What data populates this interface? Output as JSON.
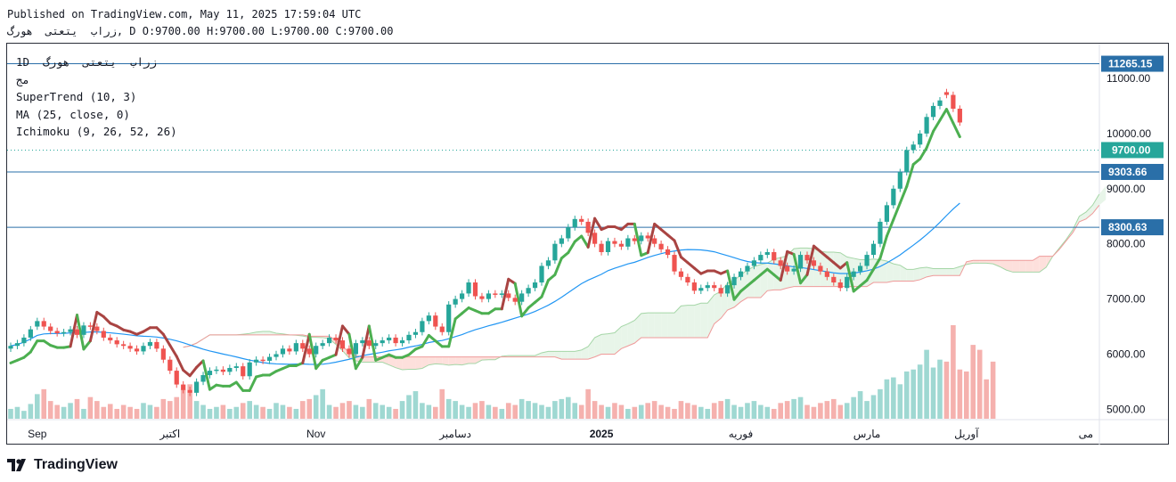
{
  "header": {
    "published": "Published on TradingView.com, May 11, 2025 17:59:04 UTC",
    "symbol_line": "زراب  يتعتى  هورگ, D O:9700.00 H:9700.00 L:9700.00 C:9700.00"
  },
  "legend": {
    "line1": "1D  زراب  يتعتى  هورگ",
    "line2": "مج",
    "supertrend": "SuperTrend (10, 3)",
    "ma": "MA (25, close, 0)",
    "ichimoku": "Ichimoku (9, 26, 52, 26)"
  },
  "brand": {
    "name": "TradingView"
  },
  "colors": {
    "up": "#26a69a",
    "down": "#ef5350",
    "supertrend_up": "#4caf50",
    "supertrend_down": "#a94442",
    "ma": "#2196f3",
    "cloud_green": "#e8f5e9",
    "cloud_red": "#fde0dc",
    "hline": "#2a6fa8",
    "price_label": "#26a69a",
    "hline_label": "#2a6fa8"
  },
  "chart_data": {
    "type": "candlestick",
    "ylim": [
      4700,
      11500
    ],
    "yticks": [
      11000,
      10000,
      9000,
      8000,
      7000,
      6000,
      5000
    ],
    "ytick_labels": [
      "11000.00",
      "10000.00",
      "9000.00",
      "8000.00",
      "7000.00",
      "6000.00",
      "5000.00"
    ],
    "xticks": [
      {
        "label": "Sep",
        "bar": 4
      },
      {
        "label": "اکتبر",
        "bar": 24
      },
      {
        "label": "Nov",
        "bar": 46
      },
      {
        "label": "دسامبر",
        "bar": 67
      },
      {
        "label": "2025",
        "bar": 89,
        "bold": true
      },
      {
        "label": "فوریه",
        "bar": 110
      },
      {
        "label": "مارس",
        "bar": 129
      },
      {
        "label": "آوریل",
        "bar": 144
      },
      {
        "label": "می",
        "bar": 162
      }
    ],
    "horizontal_lines": [
      {
        "value": 11265.15,
        "label": "11265.15"
      },
      {
        "value": 9303.66,
        "label": "9303.66"
      },
      {
        "value": 8300.63,
        "label": "8300.63"
      }
    ],
    "last_price": {
      "value": 9700.0,
      "label": "9700.00"
    },
    "close": [
      6150,
      6200,
      6300,
      6450,
      6600,
      6500,
      6420,
      6380,
      6400,
      6450,
      6350,
      6520,
      6500,
      6420,
      6300,
      6250,
      6180,
      6150,
      6100,
      6050,
      6150,
      6220,
      6100,
      5900,
      5700,
      5450,
      5350,
      5300,
      5500,
      5620,
      5700,
      5720,
      5680,
      5750,
      5780,
      5600,
      5850,
      5900,
      5880,
      5950,
      6000,
      6100,
      6050,
      6200,
      6100,
      6000,
      6150,
      6200,
      6300,
      6250,
      6100,
      6000,
      6200,
      6250,
      6150,
      6200,
      6250,
      6300,
      6200,
      6250,
      6350,
      6400,
      6600,
      6700,
      6500,
      6400,
      6900,
      7000,
      7100,
      7300,
      7050,
      7000,
      7100,
      7080,
      7100,
      7020,
      6950,
      7100,
      7200,
      7300,
      7600,
      7700,
      8000,
      8100,
      8300,
      8450,
      8400,
      8200,
      8000,
      7850,
      8050,
      8000,
      7950,
      8100,
      8050,
      8150,
      8100,
      8000,
      7900,
      7800,
      7500,
      7400,
      7300,
      7150,
      7200,
      7250,
      7200,
      7100,
      7250,
      7400,
      7500,
      7600,
      7700,
      7800,
      7850,
      7700,
      7600,
      7500,
      7550,
      7800,
      7700,
      7600,
      7500,
      7400,
      7300,
      7200,
      7400,
      7500,
      7600,
      7800,
      8000,
      8400,
      8700,
      9000,
      9300,
      9700,
      9800,
      10000,
      10300,
      10500,
      10600,
      10700,
      10450,
      10200
    ],
    "open": [
      6100,
      6150,
      6200,
      6300,
      6500,
      6600,
      6500,
      6420,
      6380,
      6400,
      6450,
      6350,
      6520,
      6500,
      6420,
      6300,
      6250,
      6180,
      6150,
      6100,
      6050,
      6150,
      6220,
      6100,
      5900,
      5700,
      5450,
      5350,
      5300,
      5500,
      5620,
      5700,
      5720,
      5680,
      5750,
      5780,
      5600,
      5850,
      5900,
      5880,
      5950,
      6000,
      6100,
      6050,
      6200,
      6100,
      6000,
      6150,
      6200,
      6300,
      6250,
      6100,
      6000,
      6200,
      6250,
      6150,
      6200,
      6250,
      6300,
      6200,
      6250,
      6350,
      6400,
      6600,
      6700,
      6500,
      6400,
      6900,
      7000,
      7100,
      7300,
      7050,
      7000,
      7100,
      7080,
      7100,
      7020,
      6950,
      7100,
      7200,
      7300,
      7600,
      7700,
      8000,
      8100,
      8300,
      8450,
      8400,
      8200,
      8000,
      7850,
      8050,
      8000,
      7950,
      8100,
      8050,
      8150,
      8100,
      8000,
      7900,
      7800,
      7500,
      7400,
      7300,
      7150,
      7200,
      7250,
      7200,
      7100,
      7250,
      7400,
      7500,
      7600,
      7700,
      7800,
      7850,
      7700,
      7600,
      7500,
      7550,
      7800,
      7700,
      7600,
      7500,
      7400,
      7300,
      7200,
      7400,
      7500,
      7600,
      7800,
      8000,
      8400,
      8700,
      9000,
      9300,
      9700,
      9800,
      10000,
      10300,
      10500,
      10750,
      10700,
      10450
    ],
    "volume": [
      10,
      12,
      8,
      15,
      25,
      30,
      18,
      14,
      12,
      16,
      20,
      10,
      22,
      18,
      12,
      15,
      10,
      14,
      12,
      10,
      16,
      14,
      12,
      20,
      18,
      22,
      30,
      35,
      18,
      14,
      10,
      12,
      14,
      10,
      12,
      16,
      18,
      14,
      12,
      10,
      16,
      14,
      12,
      10,
      18,
      20,
      24,
      30,
      14,
      12,
      16,
      18,
      14,
      12,
      20,
      16,
      14,
      12,
      10,
      18,
      24,
      28,
      16,
      14,
      12,
      30,
      20,
      18,
      14,
      12,
      16,
      18,
      14,
      12,
      10,
      16,
      14,
      20,
      18,
      16,
      14,
      12,
      18,
      20,
      22,
      16,
      14,
      30,
      18,
      14,
      12,
      16,
      14,
      10,
      12,
      14,
      16,
      18,
      14,
      12,
      10,
      18,
      16,
      14,
      12,
      10,
      16,
      18,
      20,
      14,
      12,
      16,
      18,
      14,
      12,
      10,
      16,
      18,
      20,
      22,
      14,
      12,
      16,
      18,
      20,
      14,
      16,
      22,
      28,
      18,
      24,
      30,
      40,
      42,
      35,
      48,
      50,
      55,
      70,
      52,
      60,
      58,
      95,
      50,
      48,
      75,
      70,
      40,
      58
    ]
  }
}
